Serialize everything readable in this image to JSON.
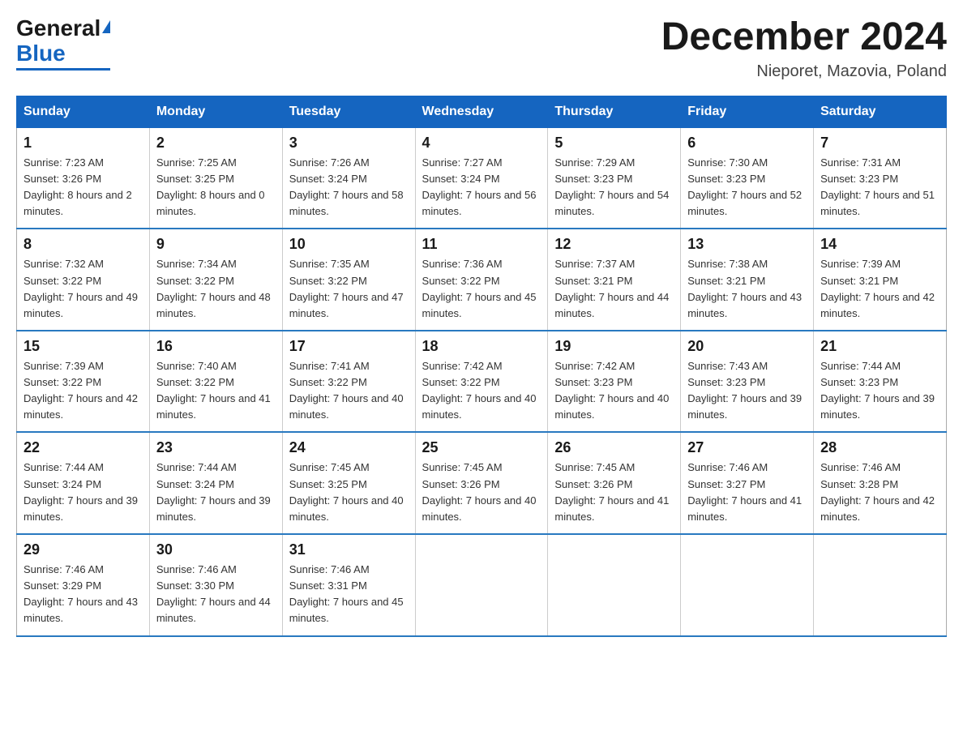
{
  "logo": {
    "general": "General",
    "blue": "Blue"
  },
  "title": {
    "month_year": "December 2024",
    "location": "Nieporet, Mazovia, Poland"
  },
  "weekdays": [
    "Sunday",
    "Monday",
    "Tuesday",
    "Wednesday",
    "Thursday",
    "Friday",
    "Saturday"
  ],
  "weeks": [
    [
      {
        "day": "1",
        "sunrise": "7:23 AM",
        "sunset": "3:26 PM",
        "daylight": "8 hours and 2 minutes."
      },
      {
        "day": "2",
        "sunrise": "7:25 AM",
        "sunset": "3:25 PM",
        "daylight": "8 hours and 0 minutes."
      },
      {
        "day": "3",
        "sunrise": "7:26 AM",
        "sunset": "3:24 PM",
        "daylight": "7 hours and 58 minutes."
      },
      {
        "day": "4",
        "sunrise": "7:27 AM",
        "sunset": "3:24 PM",
        "daylight": "7 hours and 56 minutes."
      },
      {
        "day": "5",
        "sunrise": "7:29 AM",
        "sunset": "3:23 PM",
        "daylight": "7 hours and 54 minutes."
      },
      {
        "day": "6",
        "sunrise": "7:30 AM",
        "sunset": "3:23 PM",
        "daylight": "7 hours and 52 minutes."
      },
      {
        "day": "7",
        "sunrise": "7:31 AM",
        "sunset": "3:23 PM",
        "daylight": "7 hours and 51 minutes."
      }
    ],
    [
      {
        "day": "8",
        "sunrise": "7:32 AM",
        "sunset": "3:22 PM",
        "daylight": "7 hours and 49 minutes."
      },
      {
        "day": "9",
        "sunrise": "7:34 AM",
        "sunset": "3:22 PM",
        "daylight": "7 hours and 48 minutes."
      },
      {
        "day": "10",
        "sunrise": "7:35 AM",
        "sunset": "3:22 PM",
        "daylight": "7 hours and 47 minutes."
      },
      {
        "day": "11",
        "sunrise": "7:36 AM",
        "sunset": "3:22 PM",
        "daylight": "7 hours and 45 minutes."
      },
      {
        "day": "12",
        "sunrise": "7:37 AM",
        "sunset": "3:21 PM",
        "daylight": "7 hours and 44 minutes."
      },
      {
        "day": "13",
        "sunrise": "7:38 AM",
        "sunset": "3:21 PM",
        "daylight": "7 hours and 43 minutes."
      },
      {
        "day": "14",
        "sunrise": "7:39 AM",
        "sunset": "3:21 PM",
        "daylight": "7 hours and 42 minutes."
      }
    ],
    [
      {
        "day": "15",
        "sunrise": "7:39 AM",
        "sunset": "3:22 PM",
        "daylight": "7 hours and 42 minutes."
      },
      {
        "day": "16",
        "sunrise": "7:40 AM",
        "sunset": "3:22 PM",
        "daylight": "7 hours and 41 minutes."
      },
      {
        "day": "17",
        "sunrise": "7:41 AM",
        "sunset": "3:22 PM",
        "daylight": "7 hours and 40 minutes."
      },
      {
        "day": "18",
        "sunrise": "7:42 AM",
        "sunset": "3:22 PM",
        "daylight": "7 hours and 40 minutes."
      },
      {
        "day": "19",
        "sunrise": "7:42 AM",
        "sunset": "3:23 PM",
        "daylight": "7 hours and 40 minutes."
      },
      {
        "day": "20",
        "sunrise": "7:43 AM",
        "sunset": "3:23 PM",
        "daylight": "7 hours and 39 minutes."
      },
      {
        "day": "21",
        "sunrise": "7:44 AM",
        "sunset": "3:23 PM",
        "daylight": "7 hours and 39 minutes."
      }
    ],
    [
      {
        "day": "22",
        "sunrise": "7:44 AM",
        "sunset": "3:24 PM",
        "daylight": "7 hours and 39 minutes."
      },
      {
        "day": "23",
        "sunrise": "7:44 AM",
        "sunset": "3:24 PM",
        "daylight": "7 hours and 39 minutes."
      },
      {
        "day": "24",
        "sunrise": "7:45 AM",
        "sunset": "3:25 PM",
        "daylight": "7 hours and 40 minutes."
      },
      {
        "day": "25",
        "sunrise": "7:45 AM",
        "sunset": "3:26 PM",
        "daylight": "7 hours and 40 minutes."
      },
      {
        "day": "26",
        "sunrise": "7:45 AM",
        "sunset": "3:26 PM",
        "daylight": "7 hours and 41 minutes."
      },
      {
        "day": "27",
        "sunrise": "7:46 AM",
        "sunset": "3:27 PM",
        "daylight": "7 hours and 41 minutes."
      },
      {
        "day": "28",
        "sunrise": "7:46 AM",
        "sunset": "3:28 PM",
        "daylight": "7 hours and 42 minutes."
      }
    ],
    [
      {
        "day": "29",
        "sunrise": "7:46 AM",
        "sunset": "3:29 PM",
        "daylight": "7 hours and 43 minutes."
      },
      {
        "day": "30",
        "sunrise": "7:46 AM",
        "sunset": "3:30 PM",
        "daylight": "7 hours and 44 minutes."
      },
      {
        "day": "31",
        "sunrise": "7:46 AM",
        "sunset": "3:31 PM",
        "daylight": "7 hours and 45 minutes."
      },
      null,
      null,
      null,
      null
    ]
  ]
}
